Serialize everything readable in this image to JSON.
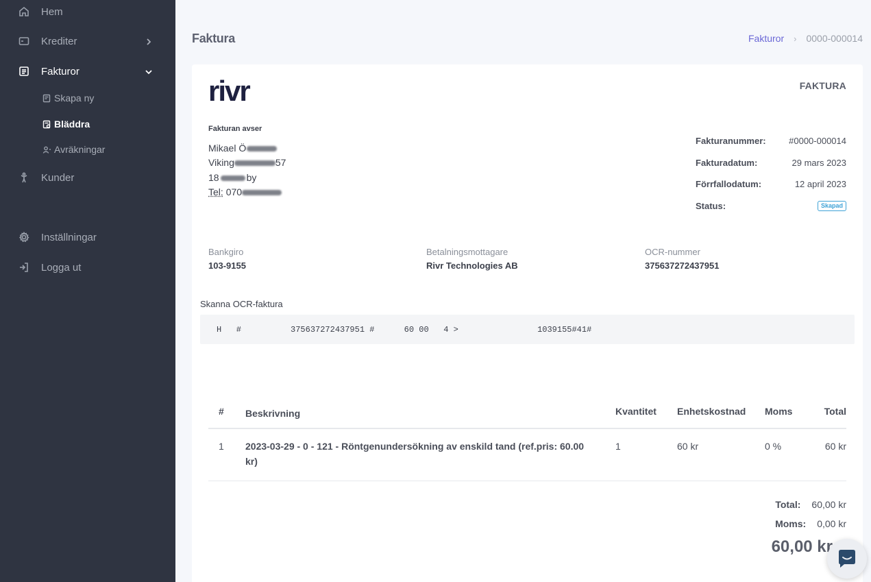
{
  "sidebar": {
    "items": [
      {
        "label": "Hem",
        "icon": "home-icon"
      },
      {
        "label": "Krediter",
        "icon": "credit-icon"
      },
      {
        "label": "Fakturor",
        "icon": "invoice-icon"
      },
      {
        "label": "Kunder",
        "icon": "customers-icon"
      },
      {
        "label": "Inställningar",
        "icon": "gear-icon"
      },
      {
        "label": "Logga ut",
        "icon": "logout-icon"
      }
    ],
    "sub_items": [
      {
        "label": "Skapa ny",
        "icon": "create-icon"
      },
      {
        "label": "Bläddra",
        "icon": "browse-icon"
      },
      {
        "label": "Avräkningar",
        "icon": "settlement-icon"
      }
    ]
  },
  "header": {
    "title": "Faktura",
    "breadcrumb": {
      "link": "Fakturor",
      "separator": "›",
      "current": "0000-000014"
    }
  },
  "invoice": {
    "logo_text": "rivr",
    "doc_type": "FAKTURA",
    "recipient": {
      "heading": "Fakturan avser",
      "line1": "Mikael Ö",
      "line2a": "Viking",
      "line2b": "57",
      "line3a": "18",
      "line3b": "by",
      "line4a": "Tel:",
      "line4b": "070"
    },
    "meta": {
      "number_label": "Fakturanummer:",
      "number": "#0000-000014",
      "date_label": "Fakturadatum:",
      "date": "29 mars 2023",
      "due_label": "Förrfallodatum:",
      "due": "12 april 2023",
      "status_label": "Status:",
      "status": "Skapad"
    },
    "payment": {
      "bankgiro_label": "Bankgiro",
      "bankgiro": "103-9155",
      "payee_label": "Betalningsmottagare",
      "payee": "Rivr Technologies AB",
      "ocr_label": "OCR-nummer",
      "ocr": "375637272437951"
    },
    "ocr_scan": {
      "title": "Skanna OCR-faktura",
      "line": "H   #          375637272437951 #      60 00   4 >                1039155#41#"
    },
    "table": {
      "headers": {
        "num": "#",
        "desc": "Beskrivning",
        "qty": "Kvantitet",
        "unit": "Enhetskostnad",
        "vat": "Moms",
        "total": "Total"
      },
      "rows": [
        {
          "num": "1",
          "desc": "2023-03-29 - 0 - 121 - Röntgenundersökning av enskild tand (ref.pris: 60.00 kr)",
          "qty": "1",
          "unit": "60 kr",
          "vat": "0 %",
          "total": "60 kr"
        }
      ]
    },
    "summary": {
      "total_label": "Total:",
      "total": "60,00 kr",
      "vat_label": "Moms:",
      "vat": "0,00 kr",
      "grand_total": "60,00 kr"
    }
  },
  "chat": {
    "icon": "chat-icon"
  },
  "colors": {
    "sidebar_bg": "#2f3441",
    "accent": "#6a67d6",
    "status": "#3ea2d6",
    "logo": "#1e2140"
  }
}
